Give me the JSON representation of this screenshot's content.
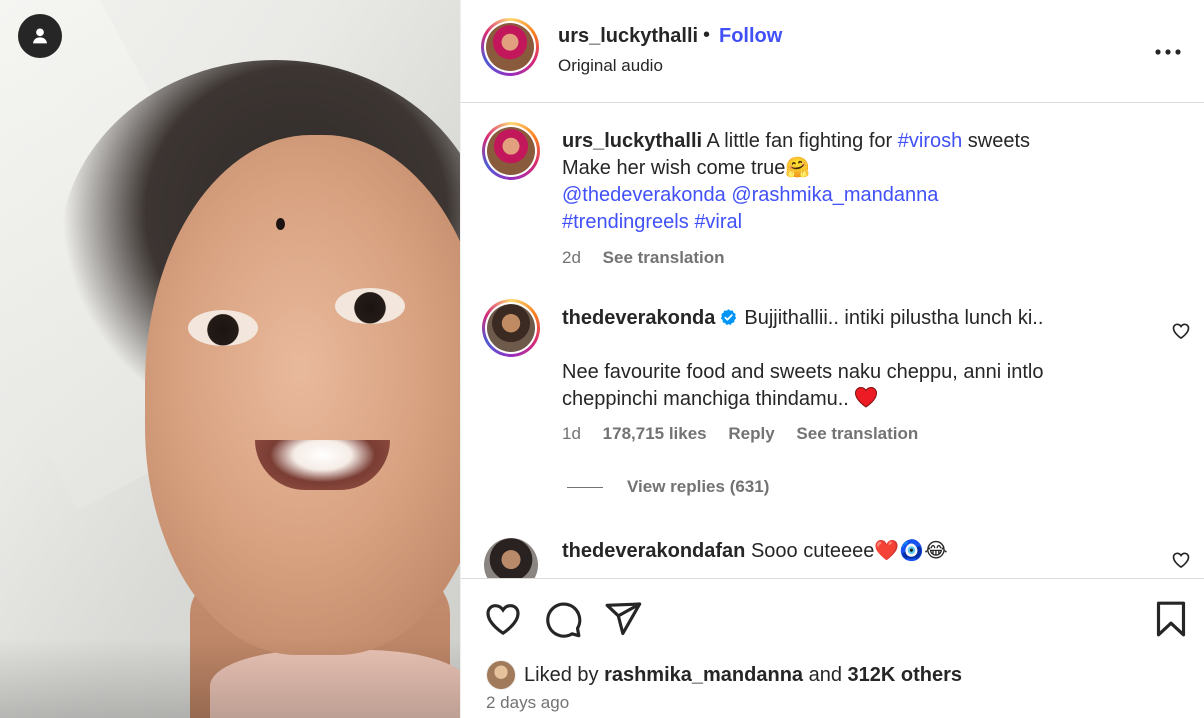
{
  "post": {
    "username": "urs_luckythalli",
    "separator": "•",
    "follow_label": "Follow",
    "audio": "Original audio",
    "more_label": "•••"
  },
  "caption": {
    "username": "urs_luckythalli",
    "text_1": "A little fan fighting for",
    "hashtag_1": "#virosh",
    "text_2": "sweets",
    "line_2": "Make her wish come true",
    "emoji_2": "🤗",
    "mention_1": "@thedeverakonda",
    "mention_2": "@rashmika_mandanna",
    "hashtag_2": "#trendingreels",
    "hashtag_3": "#viral",
    "time": "2d",
    "translation": "See translation"
  },
  "comments": [
    {
      "username": "thedeverakonda",
      "line_1": "Bujjithallii.. intiki pilustha lunch ki..",
      "line_2": "Nee favourite food and sweets naku cheppu, anni intlo",
      "line_3": "cheppinchi manchiga thindamu..",
      "emoji": "❤️",
      "time": "1d",
      "likes": "178,715 likes",
      "reply": "Reply",
      "translation": "See translation",
      "view_replies": "View replies (631)"
    },
    {
      "username": "thedeverakondafan",
      "text": "Sooo cuteeee",
      "emojis": "❤️🧿😂"
    }
  ],
  "likes": {
    "prefix": "Liked by",
    "user": "rashmika_mandanna",
    "conj": "and",
    "others": "312K others"
  },
  "posted_ago": "2 days ago",
  "colors": {
    "link": "#4150f7",
    "text": "#262626",
    "muted": "#737373",
    "verified": "#0095f6",
    "heart": "#ed1c24"
  },
  "icons": [
    "user-tag-icon",
    "more-icon",
    "like-icon",
    "comment-icon",
    "share-icon",
    "save-icon",
    "verified-icon",
    "heart-small-icon"
  ]
}
